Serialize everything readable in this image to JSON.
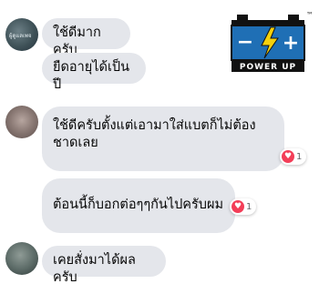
{
  "logo": {
    "text": "POWER UP",
    "tm": "™",
    "minus": "−",
    "plus": "+"
  },
  "messages": [
    {
      "text": "ใช้ดีมากครับ"
    },
    {
      "text": "ยืดอายุได้เป็นปี"
    },
    {
      "text": "ใช้ดีครับตั้งแต่เอามาใส่แบตก็ไม่ต้อง ชาดเลย",
      "reaction_count": "1"
    },
    {
      "text": "ต้อนนี้ก็บอกต่อๆๆกันไปครับผม",
      "reaction_count": "1"
    },
    {
      "text": "เคยสั่งมาได้ผลครับ"
    }
  ],
  "avatar1_caption": "ผู้ดูแลเพจ",
  "colors": {
    "bubble": "#e4e6eb",
    "heart": "#f33e58",
    "logo_blue": "#1f6fb5",
    "bolt": "#f5d10c"
  }
}
